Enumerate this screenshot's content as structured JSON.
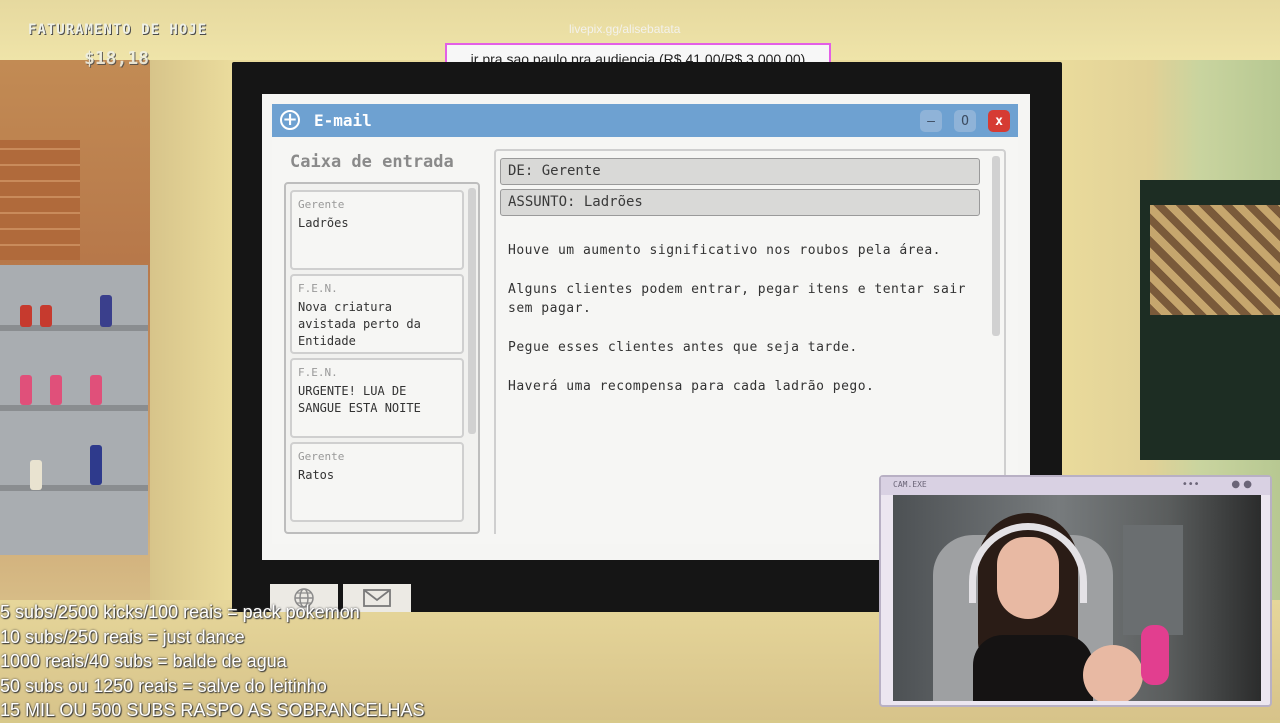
{
  "hud": {
    "revenue_label": "FATURAMENTO DE HOJE",
    "revenue_value": "$18,18"
  },
  "goal": {
    "url": "livepix.gg/alisebatata",
    "text": "ir pra sao paulo pra audiencia (R$ 41,00/R$ 3.000,00)",
    "border_color": "#e35fe6"
  },
  "email": {
    "window_title": "E-mail",
    "controls": {
      "minimize": "–",
      "maximize": "O",
      "close": "x"
    },
    "inbox_title": "Caixa de entrada",
    "inbox": [
      {
        "from": "Gerente",
        "subject": "Ladrões"
      },
      {
        "from": "F.E.N.",
        "subject": "Nova criatura avistada perto da Entidade"
      },
      {
        "from": "F.E.N.",
        "subject": "URGENTE! LUA DE SANGUE ESTA NOITE"
      },
      {
        "from": "Gerente",
        "subject": "Ratos"
      }
    ],
    "message": {
      "from": "DE: Gerente",
      "subject": "ASSUNTO: Ladrões",
      "body": [
        "Houve um aumento significativo nos roubos pela área.",
        "Alguns clientes podem entrar, pegar itens e tentar sair sem pagar.",
        "Pegue esses clientes antes que seja tarde.",
        "Haverá uma recompensa para cada ladrão pego."
      ]
    },
    "titlebar_color": "#6ea1d1",
    "close_color": "#d63b33"
  },
  "taskbar": {
    "icons": [
      "globe-icon",
      "envelope-icon"
    ]
  },
  "stream_overlay": {
    "lines": [
      "5 subs/2500 kicks/100 reais = pack pokemon",
      "10 subs/250 reais = just dance",
      "1000 reais/40 subs = balde de agua",
      "50 subs ou 1250 reais = salve do leitinho",
      "15 MIL OU 500 SUBS RASPO AS SOBRANCELHAS"
    ]
  },
  "webcam": {
    "label": "CAM.EXE"
  }
}
